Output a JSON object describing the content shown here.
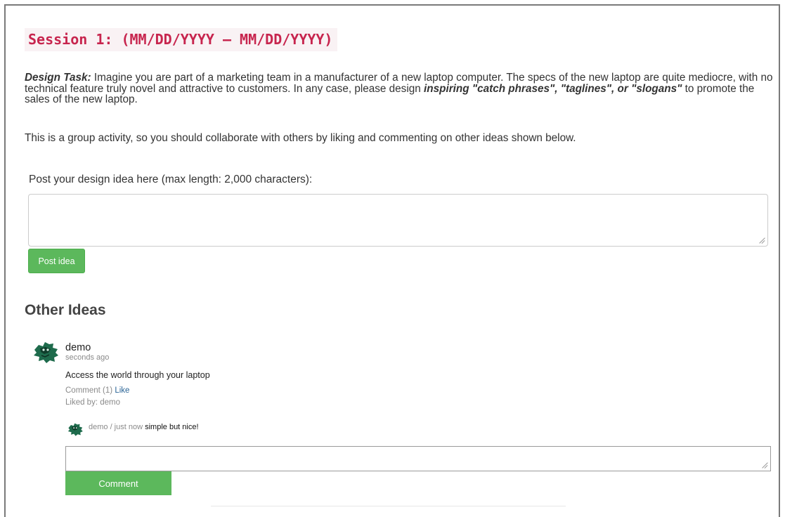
{
  "session": {
    "title": "Session 1: (MM/DD/YYYY – MM/DD/YYYY)"
  },
  "task": {
    "lead": "Design Task:",
    "body": " Imagine you are part of a marketing team in a manufacturer of a new laptop computer. The specs of the new laptop are quite mediocre, with no technical feature truly novel and attractive to customers. In any case, please design ",
    "emphasis": "inspiring \"catch phrases\", \"taglines\", or \"slogans\"",
    "tail": " to promote the sales of the new laptop.",
    "group_note": "This is a group activity, so you should collaborate with others by liking and commenting on other ideas shown below."
  },
  "post": {
    "label": "Post your design idea here (max length: 2,000 characters):",
    "value": "",
    "button": "Post idea"
  },
  "other_ideas": {
    "heading": "Other Ideas",
    "items": [
      {
        "author": "demo",
        "time": "seconds ago",
        "text": "Access the world through your laptop",
        "comment_count_label": "Comment (1)",
        "like_label": "Like",
        "liked_by": "Liked by: demo",
        "comments": [
          {
            "meta": "demo / just now",
            "text": "simple but nice!"
          }
        ],
        "comment_input_value": "",
        "comment_button": "Comment"
      }
    ]
  },
  "colors": {
    "accent_green": "#5cb85c",
    "code_red": "#c7254e",
    "code_bg": "#f9f2f4",
    "link_blue": "#2a6496",
    "avatar_green": "#1e6b4c"
  },
  "icons": {
    "avatar": "green-mascot-avatar-icon"
  }
}
